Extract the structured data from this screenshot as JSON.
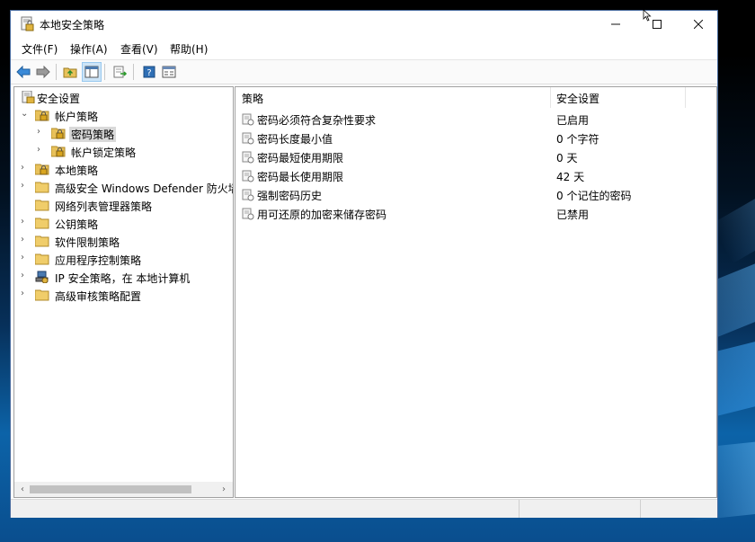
{
  "window": {
    "title": "本地安全策略",
    "controls": {
      "minimize": "—",
      "maximize": "☐",
      "close": "✕"
    }
  },
  "menu": [
    "文件(F)",
    "操作(A)",
    "查看(V)",
    "帮助(H)"
  ],
  "toolbar": [
    "back-arrow-icon",
    "forward-arrow-icon",
    "up-folder-icon",
    "show-hide-tree-icon",
    "export-list-icon",
    "help-icon",
    "properties-icon"
  ],
  "tree": [
    {
      "label": "安全设置",
      "level": 0,
      "expanded": true,
      "icon": "security-settings-icon"
    },
    {
      "label": "帐户策略",
      "level": 1,
      "expanded": true,
      "icon": "folder-lock-icon"
    },
    {
      "label": "密码策略",
      "level": 2,
      "expanded": false,
      "selected": true,
      "icon": "folder-lock-icon"
    },
    {
      "label": "帐户锁定策略",
      "level": 2,
      "expanded": false,
      "icon": "folder-lock-icon"
    },
    {
      "label": "本地策略",
      "level": 1,
      "expanded": false,
      "icon": "folder-lock-icon"
    },
    {
      "label": "高级安全 Windows Defender 防火墙",
      "level": 1,
      "expanded": false,
      "icon": "folder-icon"
    },
    {
      "label": "网络列表管理器策略",
      "level": 1,
      "expanded": null,
      "icon": "folder-icon"
    },
    {
      "label": "公钥策略",
      "level": 1,
      "expanded": false,
      "icon": "folder-icon"
    },
    {
      "label": "软件限制策略",
      "level": 1,
      "expanded": false,
      "icon": "folder-icon"
    },
    {
      "label": "应用程序控制策略",
      "level": 1,
      "expanded": false,
      "icon": "folder-icon"
    },
    {
      "label": "IP 安全策略，在 本地计算机",
      "level": 1,
      "expanded": false,
      "icon": "ipsec-policy-icon"
    },
    {
      "label": "高级审核策略配置",
      "level": 1,
      "expanded": false,
      "icon": "folder-icon"
    }
  ],
  "list": {
    "columns": [
      "策略",
      "安全设置"
    ],
    "rows": [
      {
        "policy": "密码必须符合复杂性要求",
        "setting": "已启用"
      },
      {
        "policy": "密码长度最小值",
        "setting": "0 个字符"
      },
      {
        "policy": "密码最短使用期限",
        "setting": "0 天"
      },
      {
        "policy": "密码最长使用期限",
        "setting": "42 天"
      },
      {
        "policy": "强制密码历史",
        "setting": "0 个记住的密码"
      },
      {
        "policy": "用可还原的加密来储存密码",
        "setting": "已禁用"
      }
    ]
  },
  "colors": {
    "selection": "#d9d9d9",
    "folder": "#e8c15a",
    "accent": "#2f6fb5"
  }
}
